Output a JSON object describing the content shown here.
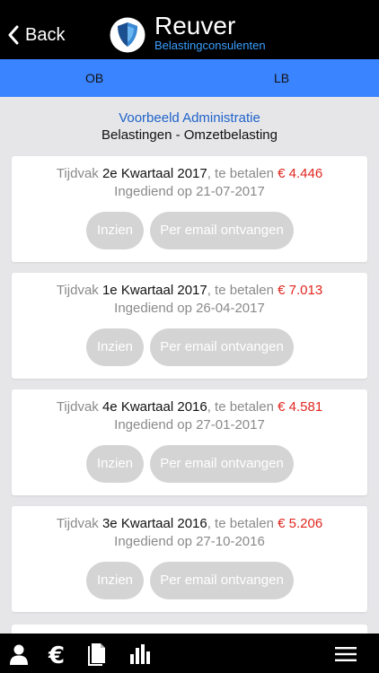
{
  "nav": {
    "back_label": "Back"
  },
  "brand": {
    "title": "Reuver",
    "subtitle": "Belastingconsulenten",
    "logo_icon": "shield-icon"
  },
  "tabs": [
    {
      "label": "OB"
    },
    {
      "label": "LB"
    }
  ],
  "header": {
    "client": "Voorbeeld Administratie",
    "tax_type": "Belastingen - Omzetbelasting"
  },
  "periods": [
    {
      "prefix": "Tijdvak",
      "period": "2e Kwartaal 2017",
      "mid": ", te betalen",
      "amount": "€ 4.446",
      "submitted": "Ingediend op 21-07-2017",
      "view_label": "Inzien",
      "email_label": "Per email ontvangen"
    },
    {
      "prefix": "Tijdvak",
      "period": "1e Kwartaal 2017",
      "mid": ", te betalen",
      "amount": "€ 7.013",
      "submitted": "Ingediend op 26-04-2017",
      "view_label": "Inzien",
      "email_label": "Per email ontvangen"
    },
    {
      "prefix": "Tijdvak",
      "period": "4e Kwartaal 2016",
      "mid": ", te betalen",
      "amount": "€ 4.581",
      "submitted": "Ingediend op 27-01-2017",
      "view_label": "Inzien",
      "email_label": "Per email ontvangen"
    },
    {
      "prefix": "Tijdvak",
      "period": "3e Kwartaal 2016",
      "mid": ", te betalen",
      "amount": "€ 5.206",
      "submitted": "Ingediend op 27-10-2016",
      "view_label": "Inzien",
      "email_label": "Per email ontvangen"
    }
  ],
  "bottom_nav": {
    "icons": [
      "user-icon",
      "euro-icon",
      "document-icon",
      "chart-icon",
      "menu-icon"
    ]
  },
  "colors": {
    "tab_bar": "#3b84ff",
    "client_text": "#1f63c9",
    "amount": "#e0261f",
    "brand_sub": "#3aa0ff",
    "button": "#d4d4d4"
  }
}
